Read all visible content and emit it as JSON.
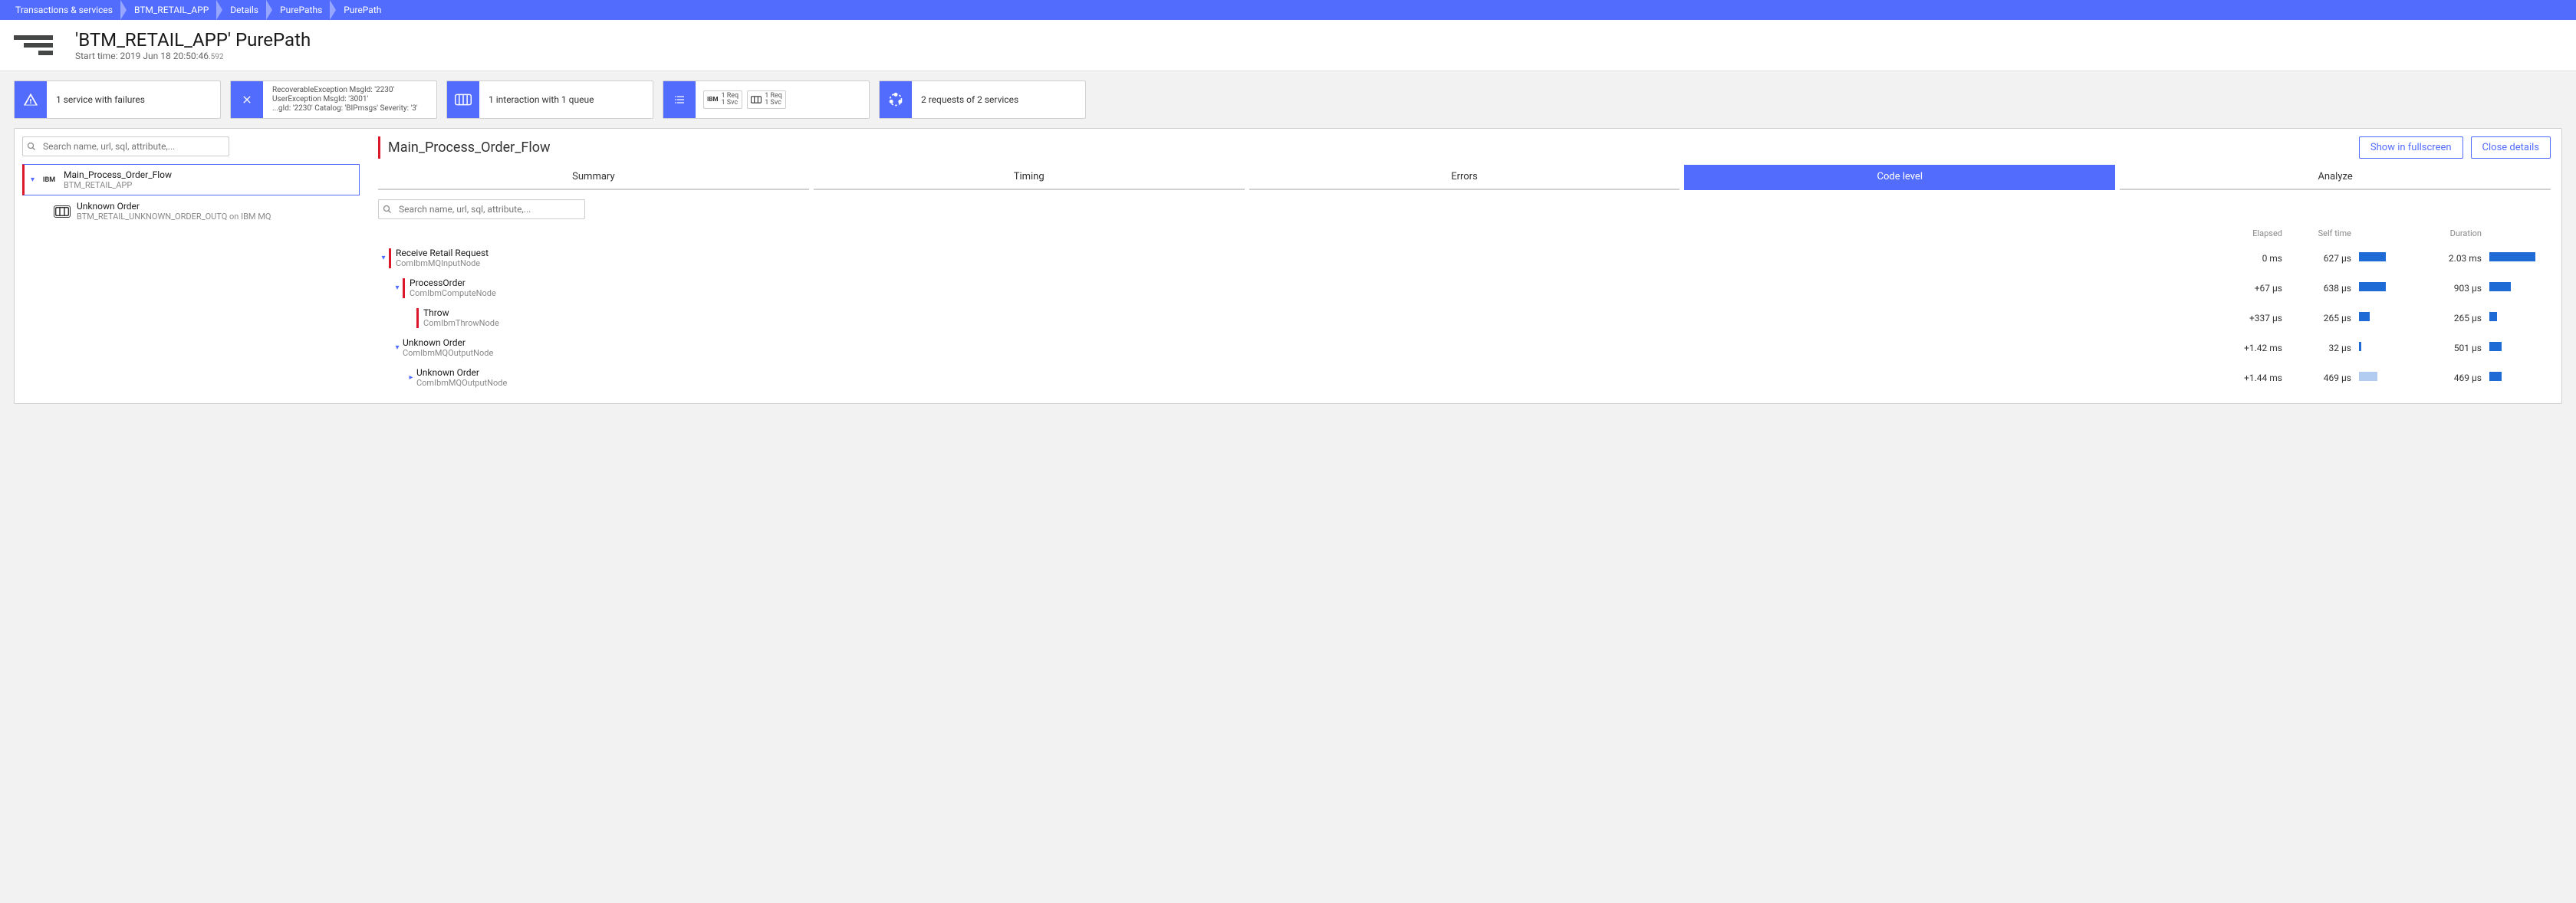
{
  "breadcrumb": [
    "Transactions & services",
    "BTM_RETAIL_APP",
    "Details",
    "PurePaths",
    "PurePath"
  ],
  "title": {
    "heading": "'BTM_RETAIL_APP' PurePath",
    "subtitle_prefix": "Start time: 2019 Jun 18 20:50:46",
    "subtitle_ms": ".592"
  },
  "cards": {
    "failures": "1 service with failures",
    "exceptions": {
      "l1": "RecoverableException MsgId: '2230'",
      "l2": "UserException MsgId: '3001'",
      "l3": "...gId: '2230' Catalog: 'BIPmsgs' Severity: '3'"
    },
    "queue": "1 interaction with 1 queue",
    "services_badges": [
      {
        "icon": "IBM",
        "req": "1 Req",
        "svc": "1 Svc"
      },
      {
        "icon": "queue",
        "req": "1 Req",
        "svc": "1 Svc"
      }
    ],
    "requests": "2 requests of 2 services"
  },
  "search_placeholder": "Search name, url, sql, attribute,...",
  "tree": [
    {
      "name": "Main_Process_Order_Flow",
      "sub": "BTM_RETAIL_APP",
      "selected": true,
      "icon": "IBM"
    },
    {
      "name": "Unknown Order",
      "sub": "BTM_RETAIL_UNKNOWN_ORDER_OUTQ on IBM MQ",
      "child": true,
      "icon": "queue"
    }
  ],
  "detail": {
    "title": "Main_Process_Order_Flow",
    "btn_fullscreen": "Show in fullscreen",
    "btn_close": "Close details"
  },
  "tabs": [
    {
      "label": "Summary",
      "active": false
    },
    {
      "label": "Timing",
      "active": false
    },
    {
      "label": "Errors",
      "active": false
    },
    {
      "label": "Code level",
      "active": true
    },
    {
      "label": "Analyze",
      "active": false
    }
  ],
  "code_headers": {
    "elapsed": "Elapsed",
    "self": "Self time",
    "duration": "Duration"
  },
  "code_rows": [
    {
      "indent": 0,
      "chev": "down",
      "red": true,
      "name": "Receive Retail Request",
      "sub": "ComIbmMQInputNode",
      "elapsed": "0 ms",
      "self": "627 µs",
      "self_bar": 35,
      "duration": "2.03 ms",
      "dur_bar": 60
    },
    {
      "indent": 1,
      "chev": "down",
      "red": true,
      "name": "ProcessOrder",
      "sub": "ComIbmComputeNode",
      "elapsed": "+67 µs",
      "self": "638 µs",
      "self_bar": 35,
      "duration": "903 µs",
      "dur_bar": 28
    },
    {
      "indent": 2,
      "chev": "",
      "red": true,
      "name": "Throw",
      "sub": "ComIbmThrowNode",
      "elapsed": "+337 µs",
      "self": "265 µs",
      "self_bar": 14,
      "duration": "265 µs",
      "dur_bar": 10
    },
    {
      "indent": 1,
      "chev": "down",
      "red": false,
      "name": "Unknown Order",
      "sub": "ComIbmMQOutputNode",
      "elapsed": "+1.42 ms",
      "self": "32 µs",
      "self_bar": 3,
      "duration": "501 µs",
      "dur_bar": 16
    },
    {
      "indent": 2,
      "chev": "right",
      "red": false,
      "name": "Unknown Order",
      "sub": "ComIbmMQOutputNode",
      "elapsed": "+1.44 ms",
      "self": "469 µs",
      "self_bar": 24,
      "self_faded": true,
      "duration": "469 µs",
      "dur_bar": 16
    }
  ]
}
